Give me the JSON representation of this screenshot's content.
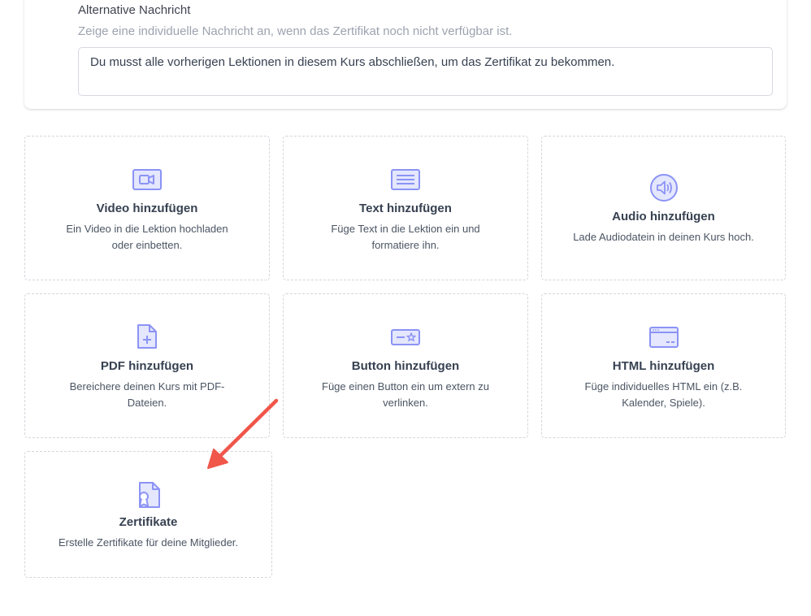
{
  "alt_message": {
    "title": "Alternative Nachricht",
    "description": "Zeige eine individuelle Nachricht an, wenn das Zertifikat noch nicht verfügbar ist.",
    "value": "Du musst alle vorherigen Lektionen in diesem Kurs abschließen, um das Zertifikat zu bekommen."
  },
  "tiles": {
    "video": {
      "icon": "video-icon",
      "title": "Video hinzufügen",
      "desc1": "Ein Video in die Lektion hochladen",
      "desc2": "oder einbetten."
    },
    "text": {
      "icon": "text-icon",
      "title": "Text hinzufügen",
      "desc1": "Füge Text in die Lektion ein und",
      "desc2": "formatiere ihn."
    },
    "audio": {
      "icon": "audio-icon",
      "title": "Audio hinzufügen",
      "desc1": "Lade Audiodatein in deinen Kurs hoch."
    },
    "pdf": {
      "icon": "pdf-add-icon",
      "title": "PDF hinzufügen",
      "desc1": "Bereichere deinen Kurs mit PDF-",
      "desc2": "Dateien."
    },
    "button": {
      "icon": "button-icon",
      "title": "Button hinzufügen",
      "desc1": "Füge einen Button ein um extern zu",
      "desc2": "verlinken."
    },
    "html": {
      "icon": "html-window-icon",
      "title": "HTML hinzufügen",
      "desc1": "Füge individuelles HTML ein (z.B.",
      "desc2": "Kalender, Spiele)."
    },
    "certificate": {
      "icon": "certificate-icon",
      "title": "Zertifikate",
      "desc1": "Erstelle Zertifikate für deine Mitglieder."
    }
  },
  "colors": {
    "icon_stroke": "#8b93f5",
    "icon_fill": "#e4e7fd",
    "arrow": "#f0564a",
    "tile_border": "#d3d6dc"
  }
}
